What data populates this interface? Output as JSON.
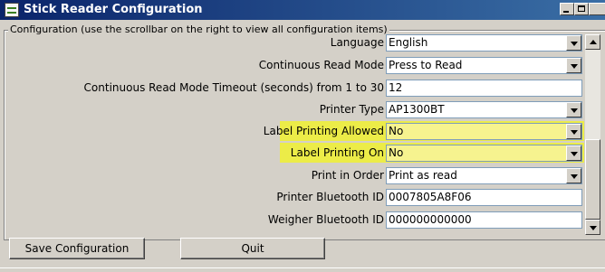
{
  "window": {
    "title": "Stick Reader Configuration",
    "app_icon": "stick-reader-icon"
  },
  "group": {
    "legend": "Configuration (use the scrollbar on the right to view all configuration items)"
  },
  "rows": [
    {
      "label": "Language",
      "value": "English",
      "type": "select",
      "highlighted": false
    },
    {
      "label": "Continuous Read Mode",
      "value": "Press to Read",
      "type": "select",
      "highlighted": false
    },
    {
      "label": "Continuous Read Mode Timeout (seconds) from 1 to 30",
      "value": "12",
      "type": "text",
      "highlighted": false
    },
    {
      "label": "Printer Type",
      "value": "AP1300BT",
      "type": "select",
      "highlighted": false
    },
    {
      "label": "Label Printing Allowed",
      "value": "No",
      "type": "select",
      "highlighted": true
    },
    {
      "label": "Label Printing On",
      "value": "No",
      "type": "select",
      "highlighted": true
    },
    {
      "label": "Print in Order",
      "value": "Print as read",
      "type": "select",
      "highlighted": false
    },
    {
      "label": "Printer Bluetooth ID",
      "value": "0007805A8F06",
      "type": "text",
      "highlighted": false
    },
    {
      "label": "Weigher Bluetooth ID",
      "value": "000000000000",
      "type": "text",
      "highlighted": false
    }
  ],
  "buttons": {
    "save": "Save Configuration",
    "quit": "Quit"
  },
  "colors": {
    "highlight": "#ecec48",
    "title_bar": "#0a246a"
  }
}
